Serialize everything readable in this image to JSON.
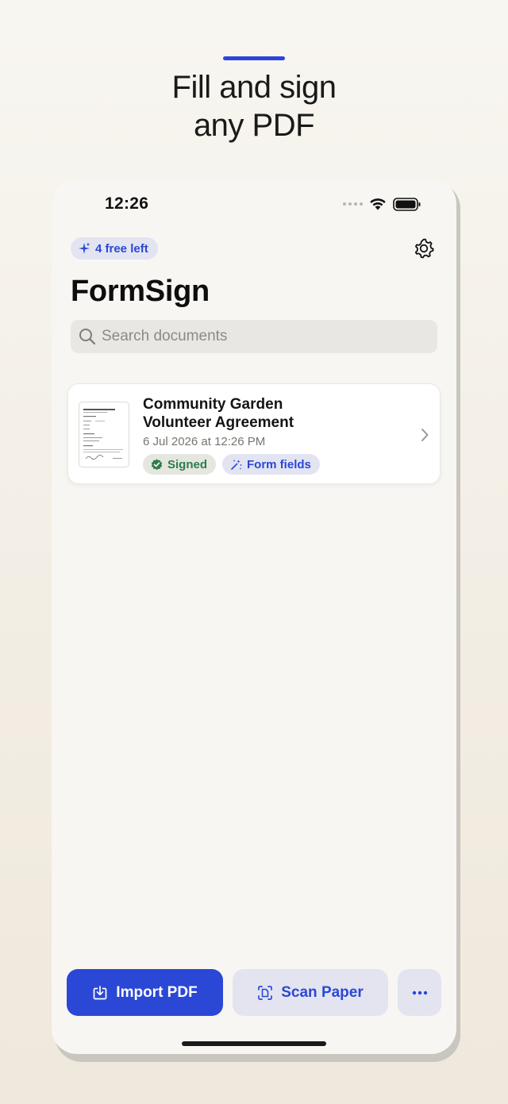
{
  "promo": {
    "headline_line1": "Fill and sign",
    "headline_line2": "any PDF",
    "accent_color": "#2b47d6"
  },
  "status_bar": {
    "time": "12:26",
    "icons": [
      "cellular-dots-icon",
      "wifi-icon",
      "battery-icon"
    ]
  },
  "header": {
    "free_badge": "4 free left",
    "free_badge_icon": "sparkles-icon",
    "settings_icon": "gear-icon",
    "title": "FormSign"
  },
  "search": {
    "placeholder": "Search documents",
    "value": "",
    "icon": "search-icon"
  },
  "documents": [
    {
      "title_line1": "Community Garden",
      "title_line2": "Volunteer Agreement",
      "date": "6 Jul 2026 at 12:26 PM",
      "badges": [
        {
          "label": "Signed",
          "icon": "checkmark-seal-icon",
          "color": "#2e7d4a"
        },
        {
          "label": "Form fields",
          "icon": "magic-wand-icon",
          "color": "#2b47d6"
        }
      ]
    }
  ],
  "actions": {
    "import_label": "Import PDF",
    "scan_label": "Scan Paper",
    "more_icon": "ellipsis-icon"
  }
}
